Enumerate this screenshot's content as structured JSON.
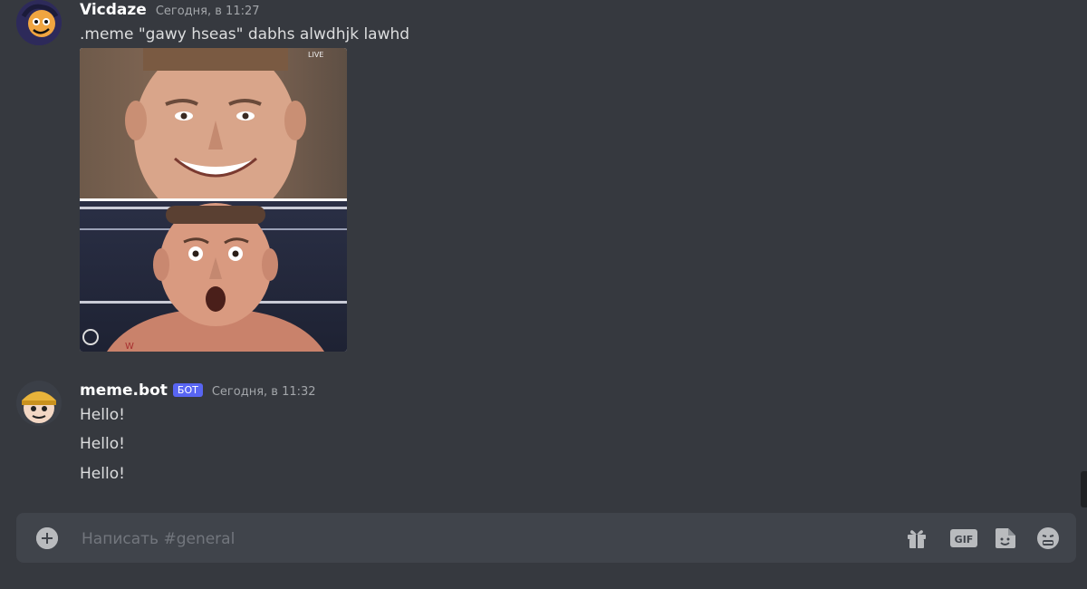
{
  "messages": [
    {
      "author": "Vicdaze",
      "timestamp": "Сегодня, в 11:27",
      "content": ".meme \"gawy hseas\" dabhs alwdhjk lawhd",
      "attachment": {
        "type": "meme-image",
        "overlay_text": "LIVE"
      }
    },
    {
      "author": "meme.bot",
      "bot_tag": "БОТ",
      "timestamp": "Сегодня, в 11:32",
      "lines": [
        "Hello!",
        "Hello!",
        "Hello!"
      ]
    }
  ],
  "composer": {
    "placeholder": "Написать #general",
    "value": "",
    "add_icon": "plus-circle-icon",
    "tools": [
      {
        "name": "gift-icon"
      },
      {
        "name": "gif-icon",
        "label": "GIF"
      },
      {
        "name": "sticker-icon"
      },
      {
        "name": "emoji-icon"
      }
    ]
  },
  "colors": {
    "background": "#36393f",
    "composer": "#40444b",
    "bot_tag": "#5865f2",
    "icons": "#b9bbbe"
  }
}
